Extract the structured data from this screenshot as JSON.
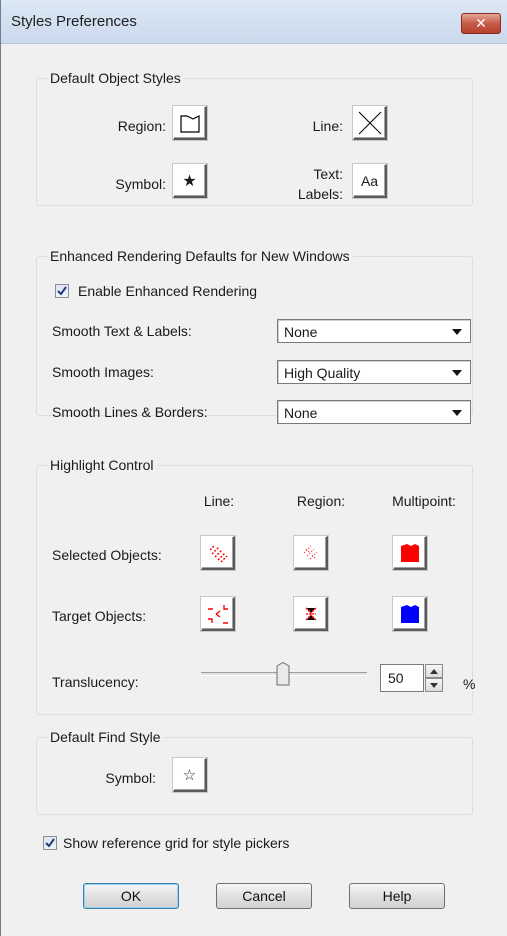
{
  "window": {
    "title": "Styles Preferences",
    "close_icon": "close-x-icon"
  },
  "default_object_styles": {
    "legend": "Default Object Styles",
    "region_label": "Region:",
    "line_label": "Line:",
    "symbol_label": "Symbol:",
    "text_labels_label_line1": "Text:",
    "text_labels_label_line2": "Labels:",
    "text_swatch": "Aa",
    "icons": [
      "region-style-icon",
      "line-style-icon",
      "star-symbol-icon",
      "text-style-icon"
    ]
  },
  "enhanced_rendering": {
    "legend": "Enhanced Rendering Defaults for New Windows",
    "enable_label": "Enable Enhanced Rendering",
    "enable_checked": true,
    "smooth_text_label": "Smooth Text & Labels:",
    "smooth_text_value": "None",
    "smooth_images_label": "Smooth Images:",
    "smooth_images_value": "High Quality",
    "smooth_lines_label": "Smooth Lines & Borders:",
    "smooth_lines_value": "None"
  },
  "highlight_control": {
    "legend": "Highlight Control",
    "col_line": "Line:",
    "col_region": "Region:",
    "col_multipoint": "Multipoint:",
    "selected_label": "Selected Objects:",
    "target_label": "Target Objects:",
    "translucency_label": "Translucency:",
    "translucency_value": "50",
    "translucency_unit": "%",
    "translucency_fraction": 0.5,
    "colors": {
      "selected_highlight": "#ff0000",
      "target_highlight": "#0000ff"
    }
  },
  "default_find_style": {
    "legend": "Default Find Style",
    "symbol_label": "Symbol:"
  },
  "show_grid": {
    "label": "Show reference grid for style pickers",
    "checked": true
  },
  "buttons": {
    "ok": "OK",
    "cancel": "Cancel",
    "help": "Help"
  }
}
